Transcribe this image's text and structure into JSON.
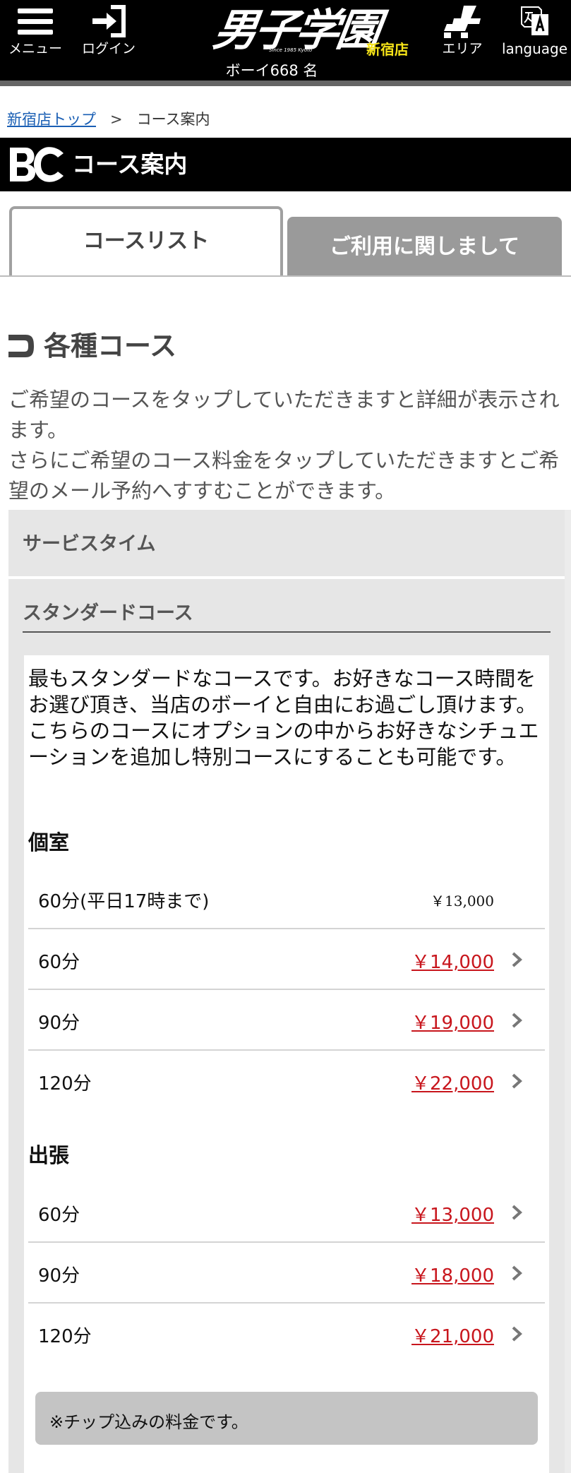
{
  "header": {
    "menu_label": "メニュー",
    "login_label": "ログイン",
    "logo_text": "男子学園",
    "logo_sub": "Since 1985 Kyoto",
    "branch": "新宿店",
    "boy_count": "ボーイ668 名",
    "area_label": "エリア",
    "language_label": "language"
  },
  "breadcrumb": {
    "home": "新宿店トップ",
    "separator": ">",
    "current": "コース案内"
  },
  "title": "コース案内",
  "tabs": [
    {
      "label": "コースリスト",
      "active": true
    },
    {
      "label": "ご利用に関しまして",
      "active": false
    }
  ],
  "section": {
    "heading": "各種コース",
    "intro_1": "ご希望のコースをタップしていただきますと詳細が表示されます。",
    "intro_2": "さらにご希望のコース料金をタップしていただきますとご希望のメール予約へすすむことができます。"
  },
  "categories": {
    "service_time": "サービスタイム",
    "standard": "スタンダードコース"
  },
  "course": {
    "desc_1": "最もスタンダードなコースです。お好きなコース時間をお選び頂き、当店のボーイと自由にお過ごし頂けます。",
    "desc_2": "こちらのコースにオプションの中からお好きなシチュエーションを追加し特別コースにすることも可能です。",
    "private_room": {
      "title": "個室",
      "rows": [
        {
          "duration": "60分(平日17時まで)",
          "price": "￥13,000"
        },
        {
          "duration": "60分",
          "price": "￥14,000"
        },
        {
          "duration": "90分",
          "price": "￥19,000"
        },
        {
          "duration": "120分",
          "price": "￥22,000"
        }
      ]
    },
    "outcall": {
      "title": "出張",
      "rows": [
        {
          "duration": "60分",
          "price": "￥13,000"
        },
        {
          "duration": "90分",
          "price": "￥18,000"
        },
        {
          "duration": "120分",
          "price": "￥21,000"
        }
      ]
    },
    "note": "※チップ込みの料金です。"
  },
  "colors": {
    "header_bg": "#000000",
    "price_link": "#c8161d",
    "branch_yellow": "#f5e318",
    "breadcrumb_link": "#1a5fb4",
    "tab_inactive": "#9a9a9a",
    "category_bg": "#e6e6e6"
  }
}
